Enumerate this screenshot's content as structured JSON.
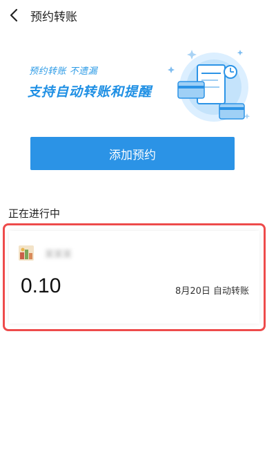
{
  "header": {
    "title": "预约转账",
    "back_icon": "chevron-left-icon"
  },
  "banner": {
    "subtitle": "预约转账 不遗漏",
    "headline": "支持自动转账和提醒",
    "colors": {
      "accent": "#2b93e6",
      "light": "#cfe8fb"
    }
  },
  "add_button": {
    "label": "添加预约"
  },
  "section": {
    "label": "正在进行中"
  },
  "appointment": {
    "payee": "某某某",
    "amount": "0.10",
    "schedule": "8月20日 自动转账"
  },
  "colors": {
    "primary": "#2b93e6",
    "highlight_border": "#ee4b4b"
  }
}
